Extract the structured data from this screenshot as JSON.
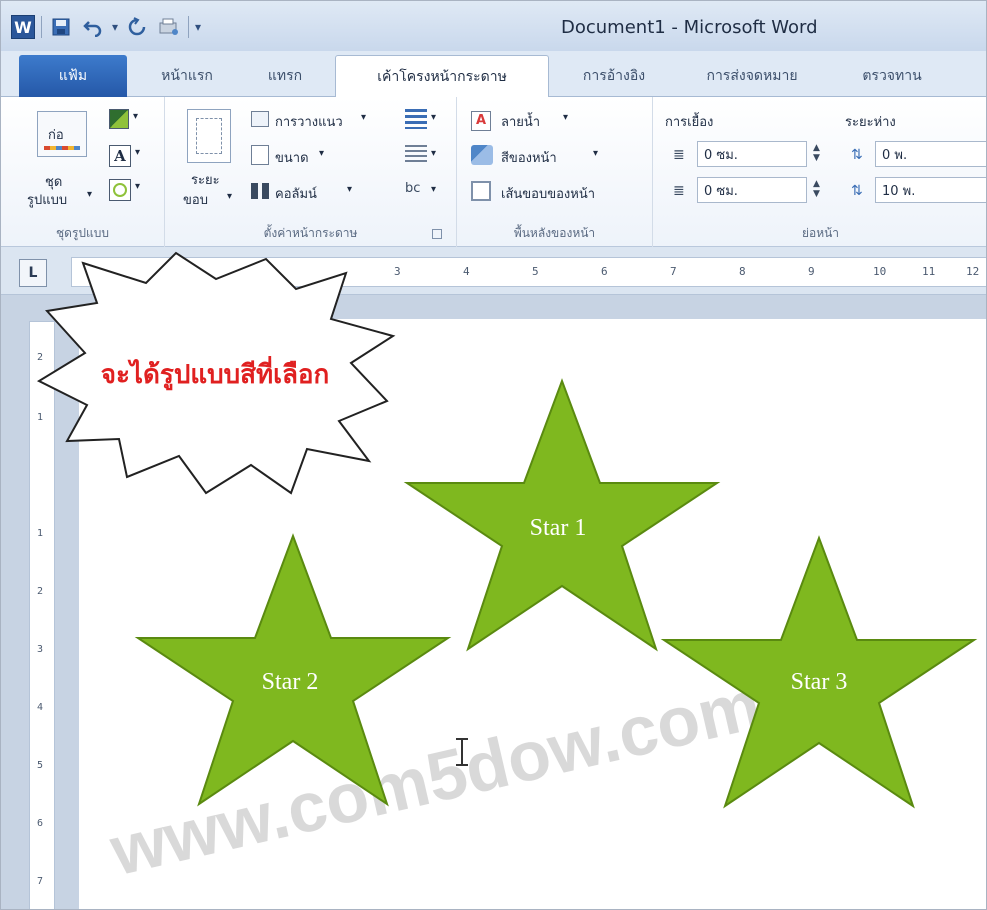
{
  "window": {
    "title": "Document1 - Microsoft Word",
    "app_icon": "W"
  },
  "tabs": [
    {
      "label": "แฟ้ม"
    },
    {
      "label": "หน้าแรก"
    },
    {
      "label": "แทรก"
    },
    {
      "label": "เค้าโครงหน้ากระดาษ"
    },
    {
      "label": "การอ้างอิง"
    },
    {
      "label": "การส่งจดหมาย"
    },
    {
      "label": "ตรวจทาน"
    }
  ],
  "ribbon": {
    "themes": {
      "button_label_1": "ชุด",
      "button_label_2": "รูปแบบ",
      "group_label": "ชุดรูปแบบ",
      "theme_icon_text": "ก่อ"
    },
    "page_setup": {
      "margins_1": "ระยะ",
      "margins_2": "ขอบ",
      "orientation": "การวางแนว",
      "size": "ขนาด",
      "columns": "คอลัมน์",
      "group_label": "ตั้งค่าหน้ากระดาษ"
    },
    "page_background": {
      "watermark": "ลายน้ำ",
      "page_color": "สีของหน้า",
      "page_borders": "เส้นขอบของหน้า",
      "group_label": "พื้นหลังของหน้า"
    },
    "paragraph": {
      "indent_title": "การเยื้อง",
      "indent_left": "0 ซม.",
      "indent_right": "0 ซม.",
      "spacing_title": "ระยะห่าง",
      "spacing_before": "0 พ.",
      "spacing_after": "10 พ.",
      "group_label": "ย่อหน้า"
    }
  },
  "document": {
    "callout_text": "จะได้รูปแบบสีที่เลือก",
    "stars": [
      {
        "label": "Star 1"
      },
      {
        "label": "Star 2"
      },
      {
        "label": "Star 3"
      }
    ],
    "watermark_text": "www.com5dow.com",
    "star_fill": "#7fb81f",
    "star_stroke": "#5a8a10",
    "callout_text_color": "#e02020"
  },
  "ruler": {
    "h_ticks": [
      "3",
      "4",
      "5",
      "6",
      "7",
      "8",
      "9",
      "10",
      "11",
      "12"
    ],
    "v_ticks": [
      "2",
      "1",
      "1",
      "2",
      "3",
      "4",
      "5",
      "6",
      "7"
    ]
  }
}
